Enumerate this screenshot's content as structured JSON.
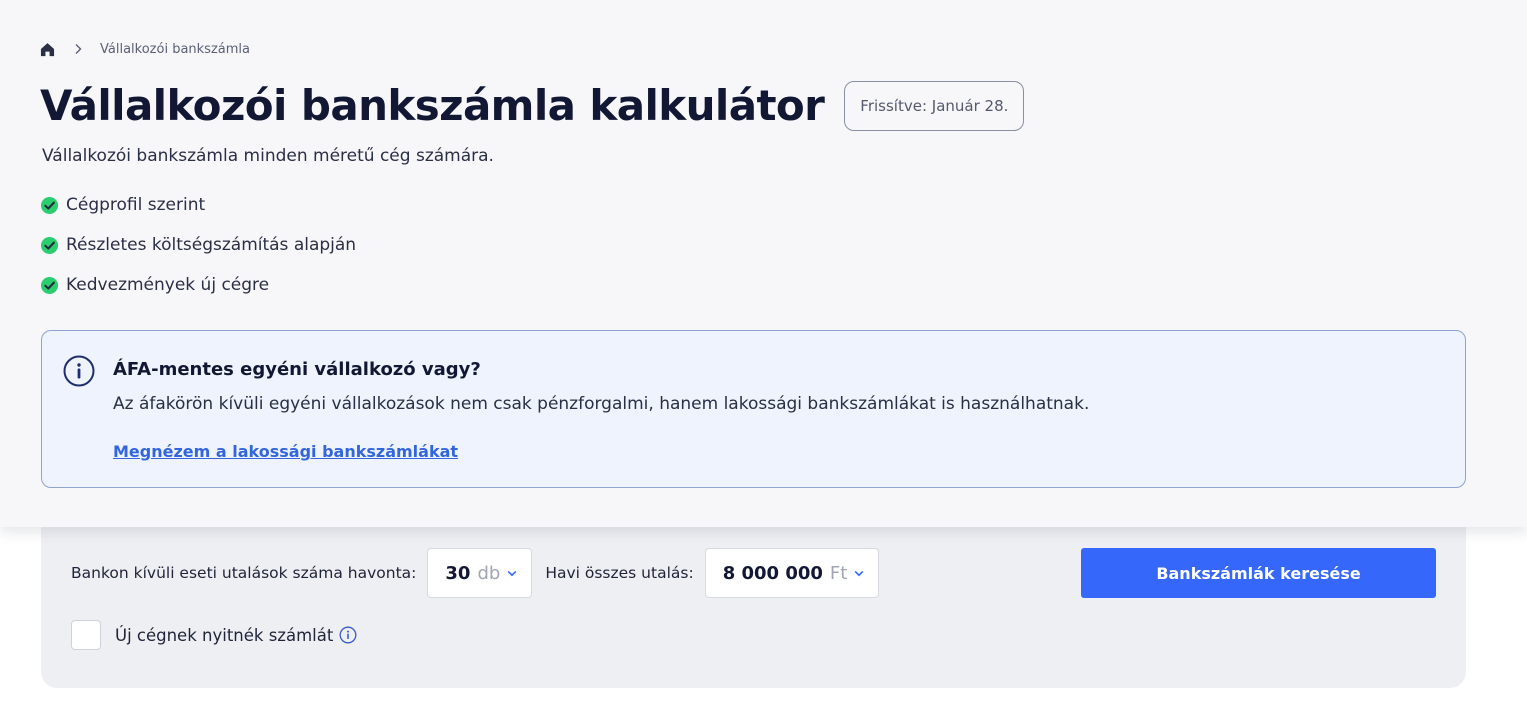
{
  "breadcrumb": {
    "home_icon": "home-icon",
    "separator_icon": "chevron-right-icon",
    "current": "Vállalkozói bankszámla"
  },
  "header": {
    "title": "Vállalkozói bankszámla kalkulátor",
    "updated_badge": "Frissítve: Január 28.",
    "subtitle": "Vállalkozói bankszámla minden méretű cég számára."
  },
  "features": [
    {
      "label": "Cégprofil szerint",
      "icon": "check-circle-icon"
    },
    {
      "label": "Részletes költségszámítás alapján",
      "icon": "check-circle-icon"
    },
    {
      "label": "Kedvezmények új cégre",
      "icon": "check-circle-icon"
    }
  ],
  "info_box": {
    "icon": "info-icon",
    "title": "ÁFA-mentes egyéni vállalkozó vagy?",
    "text": "Az áfakörön kívüli egyéni vállalkozások nem csak pénzforgalmi, hanem lakossági bankszámlákat is használhatnak.",
    "link": "Megnézem a lakossági bankszámlákat"
  },
  "filters": {
    "transfers_label": "Bankon kívüli eseti utalások száma havonta:",
    "transfers_value": "30",
    "transfers_unit": "db",
    "total_label": "Havi összes utalás:",
    "total_value": "8 000 000",
    "total_unit": "Ft",
    "search_button": "Bankszámlák keresése",
    "new_company_label": "Új cégnek nyitnék számlát",
    "new_company_checked": false
  },
  "colors": {
    "accent": "#3567fb",
    "check_green": "#2ecc71",
    "title": "#121834",
    "info_bg": "#eef3fd",
    "link": "#3366dd"
  }
}
